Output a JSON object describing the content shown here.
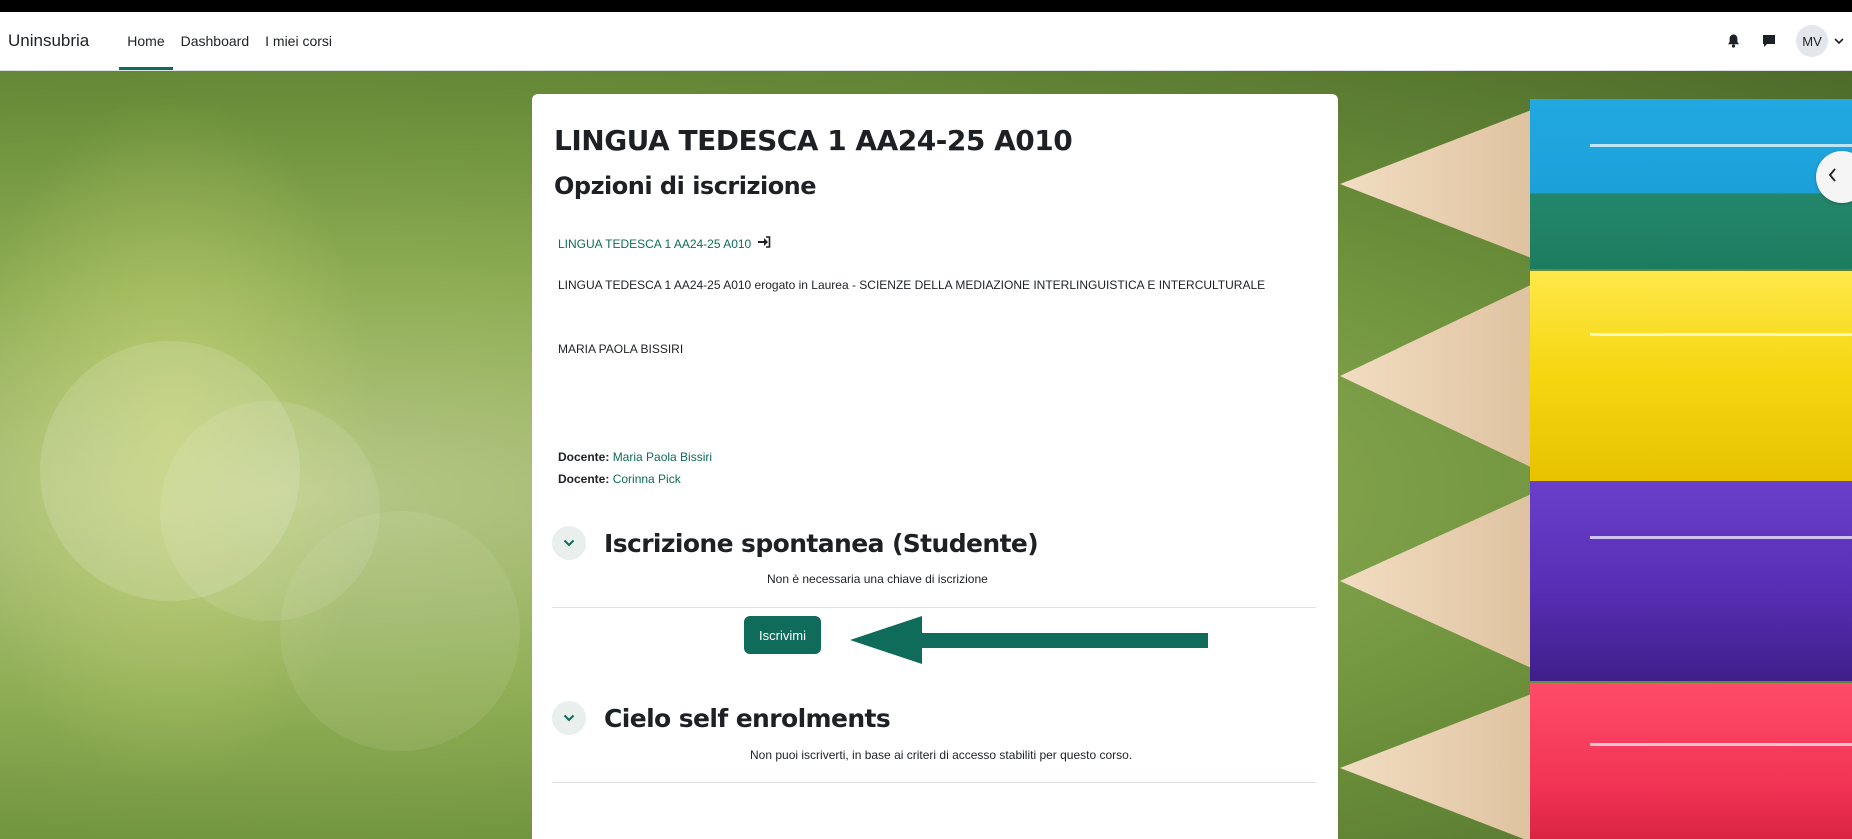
{
  "navbar": {
    "brand": "Uninsubria",
    "links": [
      "Home",
      "Dashboard",
      "I miei corsi"
    ],
    "active_link": "Home",
    "user_initials": "MV",
    "icons": [
      "bell-icon",
      "chat-icon",
      "chevron-down-icon"
    ]
  },
  "drawer": {
    "icon": "chevron-left-icon"
  },
  "course": {
    "title": "LINGUA TEDESCA 1 AA24-25 A010",
    "page_heading": "Opzioni di iscrizione",
    "link_text": "LINGUA TEDESCA 1 AA24-25 A010",
    "link_icon": "enter-icon",
    "summary": "LINGUA TEDESCA 1 AA24-25 A010 erogato in Laurea - SCIENZE DELLA MEDIAZIONE INTERLINGUISTICA E INTERCULTURALE",
    "summary_name": "MARIA PAOLA BISSIRI",
    "teachers": [
      {
        "role": "Docente:",
        "name": "Maria Paola Bissiri"
      },
      {
        "role": "Docente:",
        "name": "Corinna Pick"
      }
    ]
  },
  "enrolment_methods": [
    {
      "title": "Iscrizione spontanea (Studente)",
      "note": "Non è necessaria una chiave di iscrizione",
      "button_label": "Iscrivimi"
    },
    {
      "title": "Cielo self enrolments",
      "note": "Non puoi iscriverti, in base ai criteri di accesso stabiliti per questo corso."
    }
  ],
  "annotation": {
    "arrow_color": "#0f6b5a"
  },
  "colors": {
    "accent": "#0f6b5a",
    "chevron_bg": "#e8efed"
  }
}
